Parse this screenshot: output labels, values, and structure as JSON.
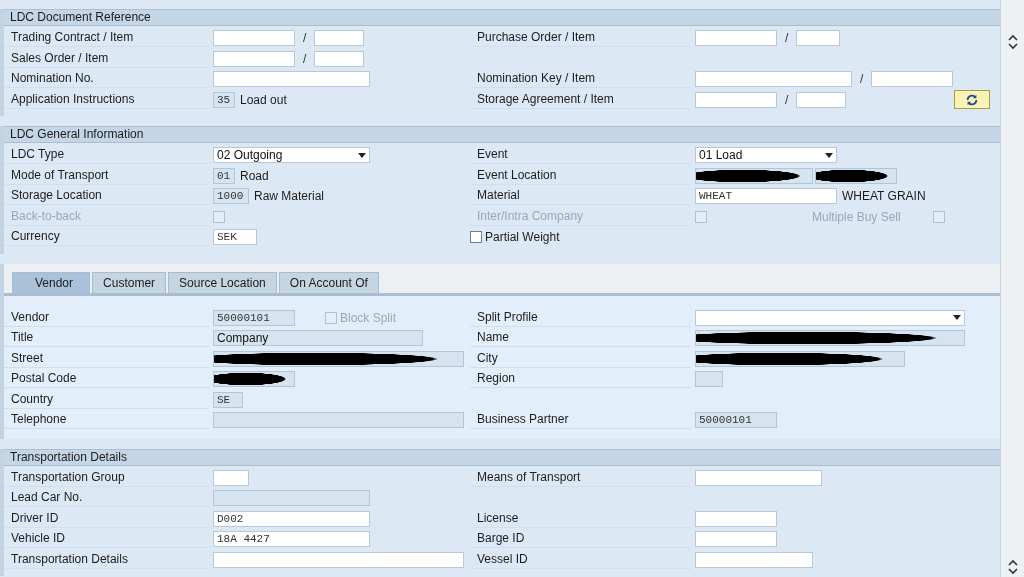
{
  "sections": [
    {
      "kind": "panel",
      "title": "LDC Document Reference",
      "rows": [
        {
          "left": {
            "label": "Trading Contract / Item",
            "controls": [
              {
                "kind": "input"
              },
              {
                "kind": "sep",
                "text": "/"
              },
              {
                "kind": "input"
              }
            ]
          },
          "right": {
            "label": "Purchase Order / Item",
            "controls": [
              {
                "kind": "input"
              },
              {
                "kind": "sep",
                "text": "/"
              },
              {
                "kind": "input"
              }
            ]
          }
        },
        {
          "left": {
            "label": "Sales Order / Item",
            "controls": [
              {
                "kind": "input"
              },
              {
                "kind": "sep",
                "text": "/"
              },
              {
                "kind": "input"
              }
            ]
          }
        },
        {
          "left": {
            "label": "Nomination No.",
            "controls": [
              {
                "kind": "input"
              }
            ]
          },
          "right": {
            "label": "Nomination Key / Item",
            "controls": [
              {
                "kind": "input"
              },
              {
                "kind": "sep",
                "text": "/"
              },
              {
                "kind": "input"
              }
            ]
          }
        },
        {
          "left": {
            "label": "Application Instructions",
            "controls": [
              {
                "kind": "input",
                "value": "35",
                "readonly": true
              },
              {
                "kind": "text",
                "text": "Load out"
              }
            ]
          },
          "right": {
            "label": "Storage Agreement / Item",
            "controls": [
              {
                "kind": "input"
              },
              {
                "kind": "sep",
                "text": "/"
              },
              {
                "kind": "input"
              },
              {
                "kind": "button"
              }
            ]
          }
        }
      ]
    },
    {
      "kind": "panel",
      "title": "LDC General Information",
      "rows": [
        {
          "left": {
            "label": "LDC Type",
            "controls": [
              {
                "kind": "select",
                "value": "02 Outgoing"
              }
            ]
          },
          "right": {
            "label": "Event",
            "controls": [
              {
                "kind": "select",
                "value": "01 Load"
              }
            ]
          }
        },
        {
          "left": {
            "label": "Mode of Transport",
            "controls": [
              {
                "kind": "input",
                "value": "01",
                "readonly": true
              },
              {
                "kind": "text",
                "text": "Road"
              }
            ]
          },
          "right": {
            "label": "Event Location",
            "controls": [
              {
                "kind": "input",
                "readonly": true,
                "redacted": true
              },
              {
                "kind": "input",
                "readonly": true,
                "redacted": true
              }
            ]
          }
        },
        {
          "left": {
            "label": "Storage Location",
            "controls": [
              {
                "kind": "input",
                "value": "1000",
                "readonly": true
              },
              {
                "kind": "text",
                "text": "Raw Material"
              }
            ]
          },
          "right": {
            "label": "Material",
            "controls": [
              {
                "kind": "input",
                "value": "WHEAT"
              },
              {
                "kind": "text",
                "text": "WHEAT GRAIN"
              }
            ]
          }
        },
        {
          "left": {
            "label": "Back-to-back",
            "disabled": true,
            "controls": [
              {
                "kind": "checkbox",
                "checked": false,
                "disabled": true
              }
            ]
          },
          "right": {
            "label": "Inter/Intra Company",
            "disabled": true,
            "controls": [
              {
                "kind": "checkbox",
                "checked": false,
                "disabled": true
              },
              {
                "kind": "text",
                "text": "Multiple Buy Sell",
                "disabled": true
              },
              {
                "kind": "checkbox",
                "checked": false,
                "disabled": true
              }
            ]
          }
        },
        {
          "left": {
            "label": "Currency",
            "controls": [
              {
                "kind": "input",
                "value": "SEK"
              }
            ]
          },
          "right": {
            "controls": [
              {
                "kind": "checkbox",
                "checked": false,
                "disabled": false,
                "text": "Partial Weight"
              }
            ]
          }
        }
      ]
    },
    {
      "kind": "tabbed",
      "tabs": [
        {
          "label": "Vendor",
          "selected": true
        },
        {
          "label": "Customer",
          "selected": false
        },
        {
          "label": "Source Location",
          "selected": false
        },
        {
          "label": "On Account Of",
          "selected": false
        }
      ],
      "rows": [
        {
          "left": {
            "label": "Vendor",
            "controls": [
              {
                "kind": "input",
                "value": "50000101",
                "readonly": true
              },
              {
                "kind": "checkbox",
                "checked": false,
                "disabled": true,
                "text": "Block Split"
              }
            ]
          },
          "right": {
            "label": "Split Profile",
            "controls": [
              {
                "kind": "select"
              }
            ]
          }
        },
        {
          "left": {
            "label": "Title",
            "controls": [
              {
                "kind": "input",
                "value": "Company",
                "readonly": true
              }
            ]
          },
          "right": {
            "label": "Name",
            "controls": [
              {
                "kind": "input",
                "readonly": true,
                "redacted": true
              }
            ]
          }
        },
        {
          "left": {
            "label": "Street",
            "controls": [
              {
                "kind": "input",
                "readonly": true,
                "redacted": true
              }
            ]
          },
          "right": {
            "label": "City",
            "controls": [
              {
                "kind": "input",
                "readonly": true,
                "redacted": true
              }
            ]
          }
        },
        {
          "left": {
            "label": "Postal Code",
            "controls": [
              {
                "kind": "input",
                "readonly": true,
                "redacted": true
              }
            ]
          },
          "right": {
            "label": "Region",
            "controls": [
              {
                "kind": "input",
                "readonly": true
              }
            ]
          }
        },
        {
          "left": {
            "label": "Country",
            "controls": [
              {
                "kind": "input",
                "value": "SE",
                "readonly": true
              }
            ]
          }
        },
        {
          "left": {
            "label": "Telephone",
            "controls": [
              {
                "kind": "input",
                "readonly": true
              }
            ]
          },
          "right": {
            "label": "Business Partner",
            "controls": [
              {
                "kind": "input",
                "value": "50000101",
                "readonly": true
              }
            ]
          }
        }
      ]
    },
    {
      "kind": "panel",
      "title": "Transportation Details",
      "rows": [
        {
          "left": {
            "label": "Transportation Group",
            "controls": [
              {
                "kind": "input"
              }
            ]
          },
          "right": {
            "label": "Means of Transport",
            "controls": [
              {
                "kind": "input"
              }
            ]
          }
        },
        {
          "left": {
            "label": "Lead Car No.",
            "controls": [
              {
                "kind": "input",
                "readonly": true
              }
            ]
          }
        },
        {
          "left": {
            "label": "Driver ID",
            "controls": [
              {
                "kind": "input",
                "value": "D002"
              }
            ]
          },
          "right": {
            "label": "License",
            "controls": [
              {
                "kind": "input"
              }
            ]
          }
        },
        {
          "left": {
            "label": "Vehicle ID",
            "controls": [
              {
                "kind": "input",
                "value": "18A 4427"
              }
            ]
          },
          "right": {
            "label": "Barge ID",
            "controls": [
              {
                "kind": "input"
              }
            ]
          }
        },
        {
          "left": {
            "label": "Transportation Details",
            "controls": [
              {
                "kind": "input"
              }
            ]
          },
          "right": {
            "label": "Vessel ID",
            "controls": [
              {
                "kind": "input"
              }
            ]
          }
        }
      ]
    }
  ]
}
